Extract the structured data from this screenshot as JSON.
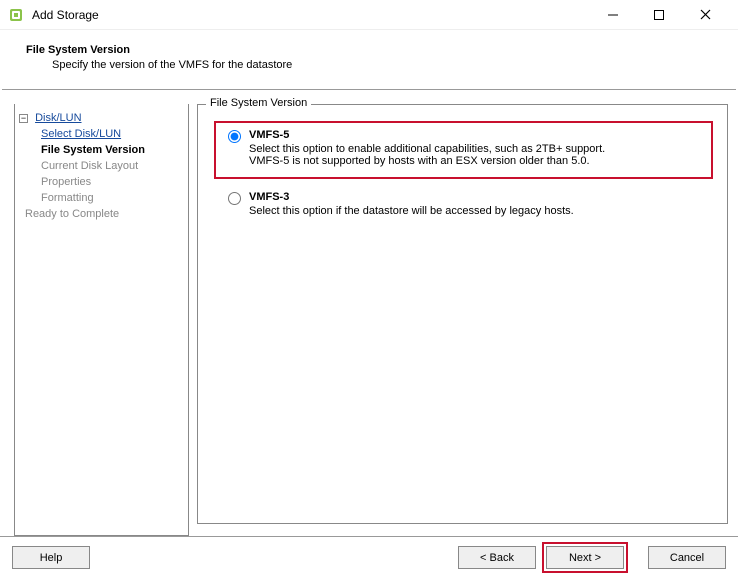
{
  "window": {
    "title": "Add Storage"
  },
  "header": {
    "title": "File System Version",
    "subtitle": "Specify the version of the VMFS for the datastore"
  },
  "sidebar": {
    "root": "Disk/LUN",
    "items": [
      {
        "label": "Select Disk/LUN"
      },
      {
        "label": "File System Version"
      },
      {
        "label": "Current Disk Layout"
      },
      {
        "label": "Properties"
      },
      {
        "label": "Formatting"
      }
    ],
    "ready": "Ready to Complete"
  },
  "group": {
    "label": "File System Version"
  },
  "options": {
    "vmfs5": {
      "label": "VMFS-5",
      "desc1": "Select this option to enable additional capabilities, such as 2TB+ support.",
      "desc2": "VMFS-5 is not supported by hosts with an ESX version older than 5.0."
    },
    "vmfs3": {
      "label": "VMFS-3",
      "desc": "Select this option if the datastore will be accessed by legacy hosts."
    }
  },
  "buttons": {
    "help": "Help",
    "back": "< Back",
    "next": "Next >",
    "cancel": "Cancel"
  }
}
